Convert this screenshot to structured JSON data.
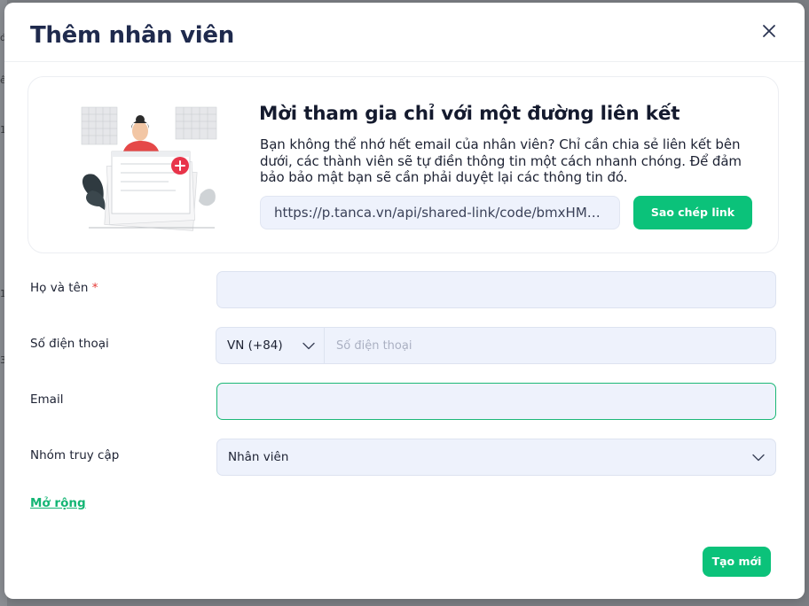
{
  "background_glyphs": [
    "đ",
    "ê",
    "1",
    "1",
    "3"
  ],
  "modal": {
    "title": "Thêm nhân viên",
    "close_icon": "close-icon"
  },
  "invite": {
    "title": "Mời tham gia chỉ với một đường liên kết",
    "description": "Bạn không thể nhớ hết email của nhân viên? Chỉ cần chia sẻ liên kết bên dưới, các thành viên sẽ tự điền thông tin một cách nhanh chóng. Để đảm bảo bảo mật bạn sẽ cần phải duyệt lại các thông tin đó.",
    "link": "https://p.tanca.vn/api/shared-link/code/bmxHMGlFY...",
    "copy_label": "Sao chép link"
  },
  "form": {
    "full_name": {
      "label": "Họ và tên",
      "required_mark": "*",
      "value": ""
    },
    "phone": {
      "label": "Số điện thoại",
      "country": "VN (+84)",
      "placeholder": "Số điện thoại",
      "value": ""
    },
    "email": {
      "label": "Email",
      "value": ""
    },
    "group": {
      "label": "Nhóm truy cập",
      "selected": "Nhân viên"
    }
  },
  "expand_label": "Mở rộng",
  "create_label": "Tạo mới",
  "colors": {
    "accent": "#0bc27a",
    "title": "#1f2a4d",
    "field_bg": "#eef2fc",
    "required": "#e53935"
  }
}
